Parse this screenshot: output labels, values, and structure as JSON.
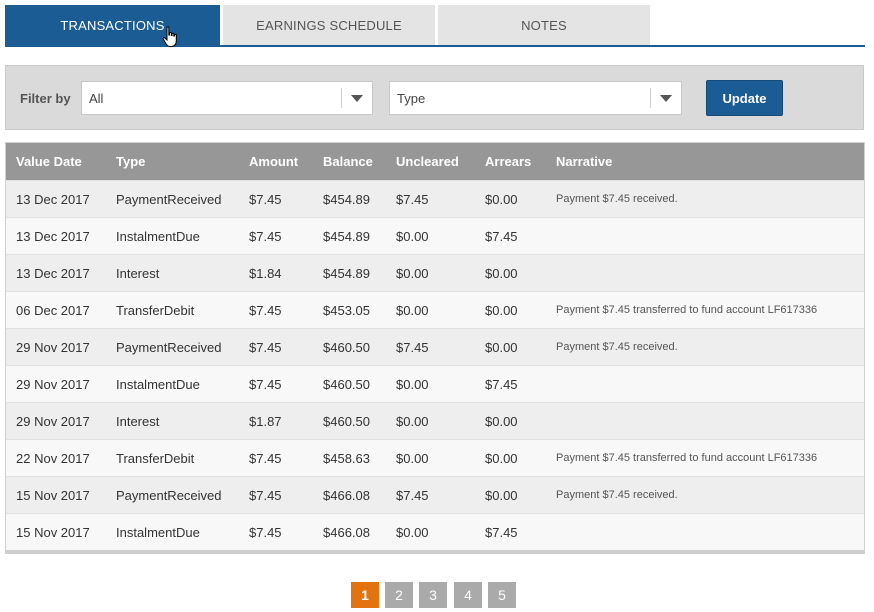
{
  "tabs": [
    {
      "label": "TRANSACTIONS",
      "active": true
    },
    {
      "label": "EARNINGS SCHEDULE",
      "active": false
    },
    {
      "label": "NOTES",
      "active": false
    }
  ],
  "filter": {
    "label": "Filter by",
    "select1_value": "All",
    "select2_value": "Type",
    "update_label": "Update"
  },
  "table": {
    "headers": [
      "Value Date",
      "Type",
      "Amount",
      "Balance",
      "Uncleared",
      "Arrears",
      "Narrative"
    ],
    "rows": [
      [
        "13 Dec 2017",
        "PaymentReceived",
        "$7.45",
        "$454.89",
        "$7.45",
        "$0.00",
        "Payment $7.45 received."
      ],
      [
        "13 Dec 2017",
        "InstalmentDue",
        "$7.45",
        "$454.89",
        "$0.00",
        "$7.45",
        ""
      ],
      [
        "13 Dec 2017",
        "Interest",
        "$1.84",
        "$454.89",
        "$0.00",
        "$0.00",
        ""
      ],
      [
        "06 Dec 2017",
        "TransferDebit",
        "$7.45",
        "$453.05",
        "$0.00",
        "$0.00",
        "Payment $7.45 transferred to fund account LF617336"
      ],
      [
        "29 Nov 2017",
        "PaymentReceived",
        "$7.45",
        "$460.50",
        "$7.45",
        "$0.00",
        "Payment $7.45 received."
      ],
      [
        "29 Nov 2017",
        "InstalmentDue",
        "$7.45",
        "$460.50",
        "$0.00",
        "$7.45",
        ""
      ],
      [
        "29 Nov 2017",
        "Interest",
        "$1.87",
        "$460.50",
        "$0.00",
        "$0.00",
        ""
      ],
      [
        "22 Nov 2017",
        "TransferDebit",
        "$7.45",
        "$458.63",
        "$0.00",
        "$0.00",
        "Payment $7.45 transferred to fund account LF617336"
      ],
      [
        "15 Nov 2017",
        "PaymentReceived",
        "$7.45",
        "$466.08",
        "$7.45",
        "$0.00",
        "Payment $7.45 received."
      ],
      [
        "15 Nov 2017",
        "InstalmentDue",
        "$7.45",
        "$466.08",
        "$0.00",
        "$7.45",
        ""
      ]
    ]
  },
  "pagination": {
    "pages": [
      "1",
      "2",
      "3",
      "4",
      "5"
    ],
    "current": "1"
  },
  "colors": {
    "accent": "#1c5c95",
    "current_page": "#e2730e",
    "header_bg": "#979797"
  },
  "icons": {
    "cursor": "hand-pointer-icon",
    "dropdown": "chevron-down-icon"
  }
}
